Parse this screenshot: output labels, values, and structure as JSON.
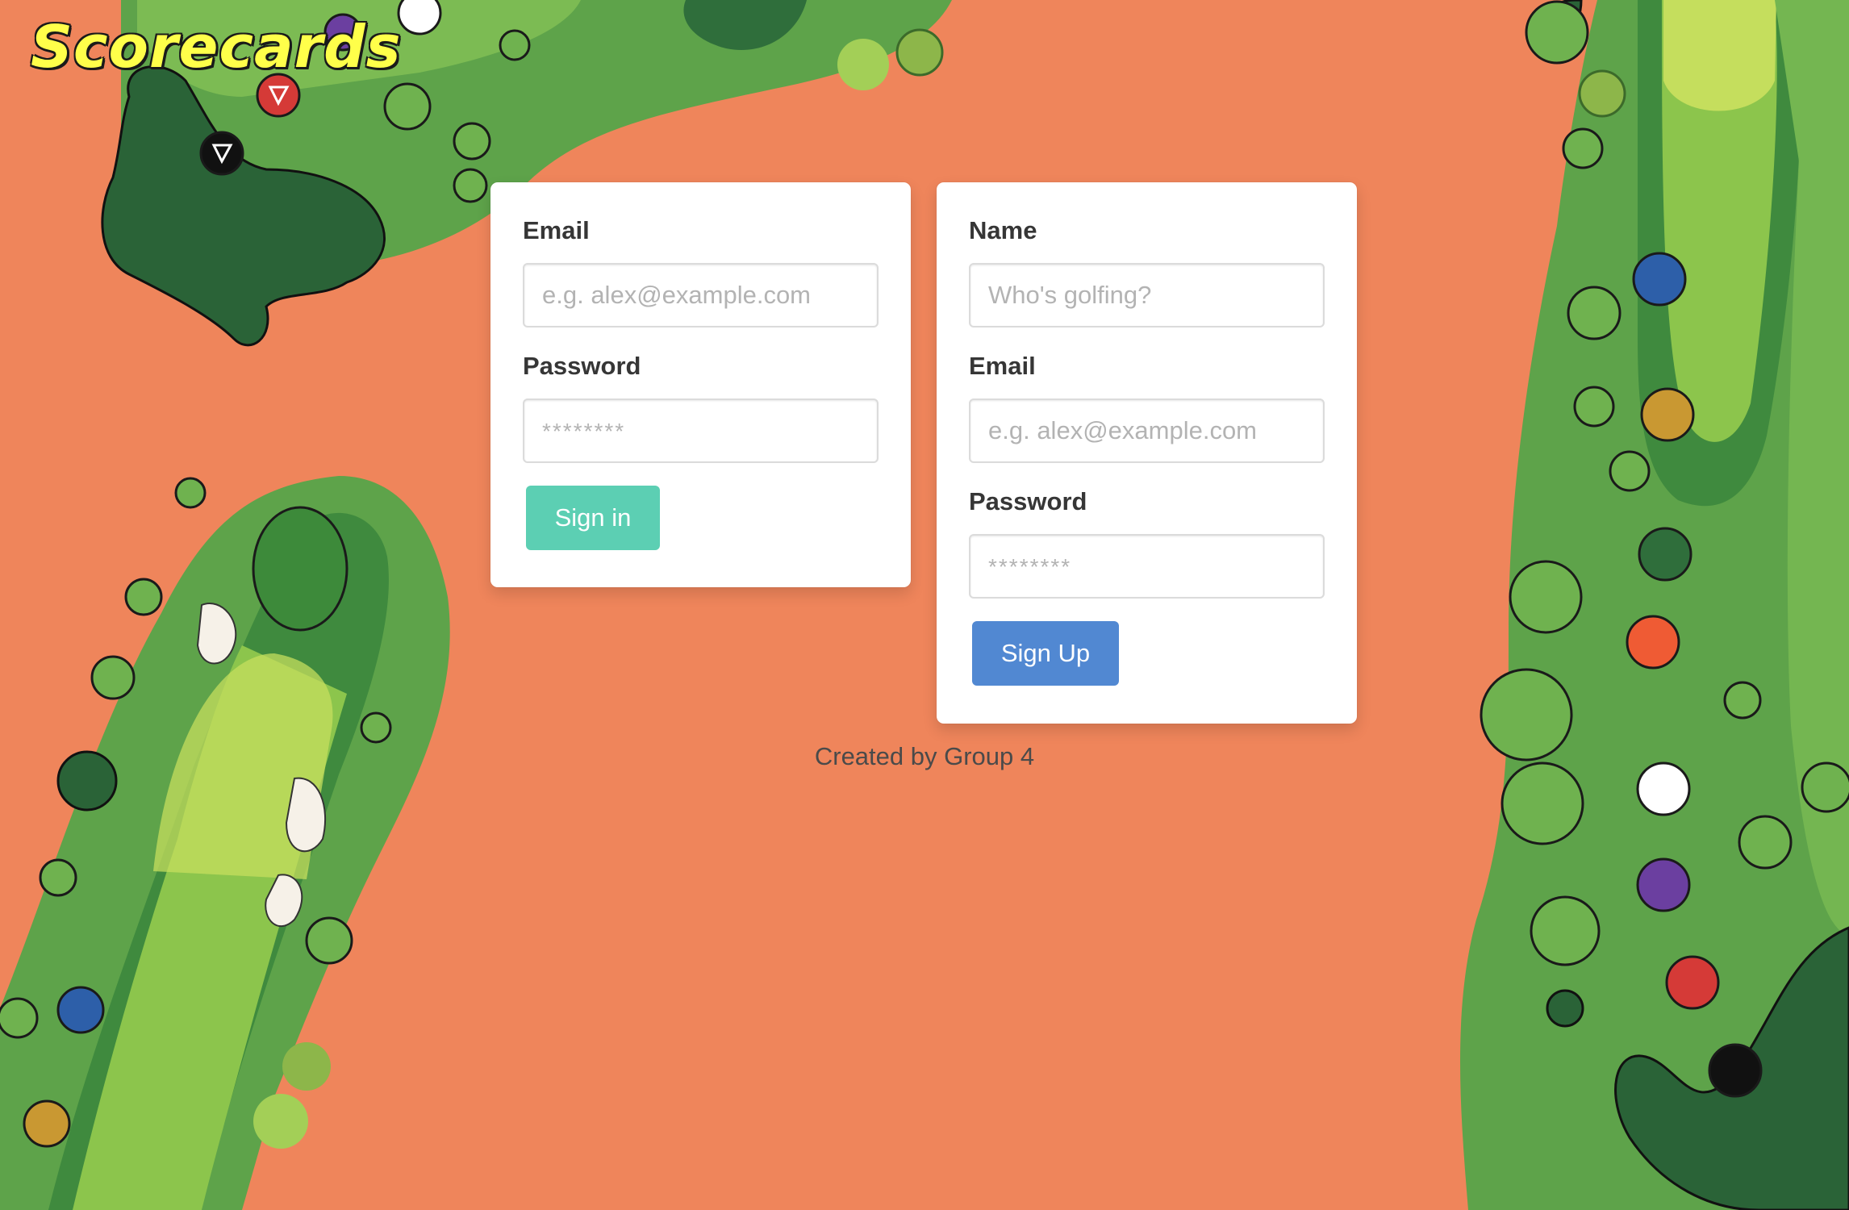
{
  "app": {
    "title": "Scorecards"
  },
  "signin": {
    "email_label": "Email",
    "email_placeholder": "e.g. alex@example.com",
    "password_label": "Password",
    "password_placeholder": "********",
    "submit_label": "Sign in"
  },
  "signup": {
    "name_label": "Name",
    "name_placeholder": "Who's golfing?",
    "email_label": "Email",
    "email_placeholder": "e.g. alex@example.com",
    "password_label": "Password",
    "password_placeholder": "********",
    "submit_label": "Sign Up"
  },
  "footer": {
    "credit": "Created by Group 4"
  },
  "colors": {
    "background": "#ef855b",
    "signin_button": "#5ccfb3",
    "signup_button": "#5188d2",
    "title_text": "#ffff4a",
    "rough": "#5ea34a",
    "fairway": "#74b651",
    "trees": "#2e6b3c"
  }
}
